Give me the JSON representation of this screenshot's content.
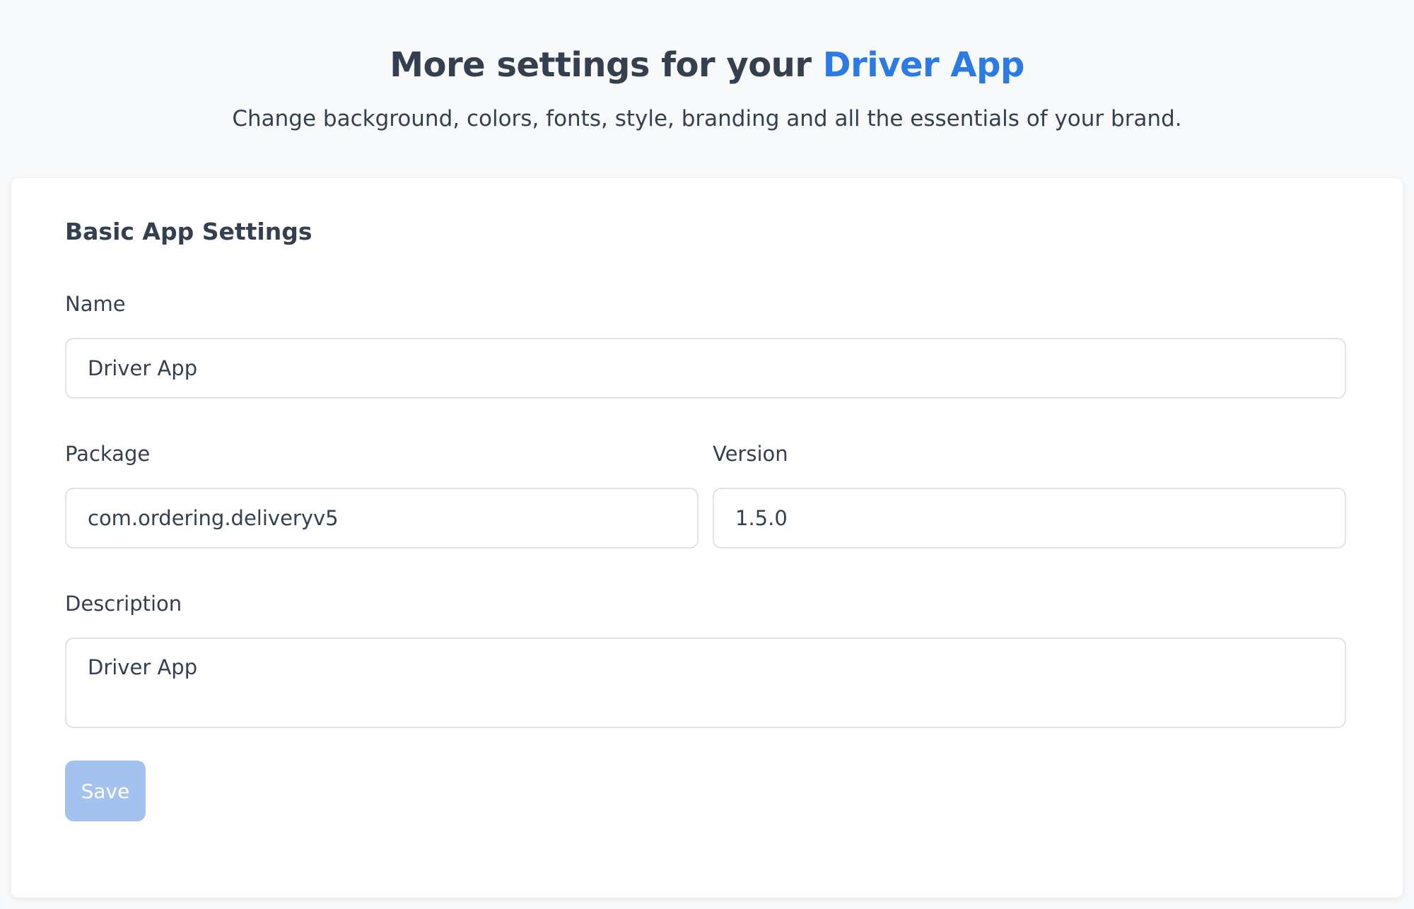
{
  "header": {
    "title_prefix": "More settings for your",
    "title_accent": "Driver App",
    "subtitle": "Change background, colors, fonts, style, branding and all the essentials of your brand."
  },
  "card": {
    "title": "Basic App Settings",
    "name": {
      "label": "Name",
      "value": "Driver App"
    },
    "package": {
      "label": "Package",
      "value": "com.ordering.deliveryv5"
    },
    "version": {
      "label": "Version",
      "value": "1.5.0"
    },
    "description": {
      "label": "Description",
      "value": "Driver App"
    },
    "save_label": "Save"
  },
  "colors": {
    "accent": "#2c7be5",
    "text": "#344050",
    "button_disabled": "#a4c2f0",
    "border": "#dfe3e8"
  }
}
